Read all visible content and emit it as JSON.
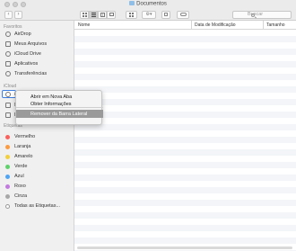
{
  "window": {
    "title": "Documentos"
  },
  "toolbar": {
    "back_label": "‹",
    "forward_label": "›",
    "action_label": "⚙▾",
    "search_placeholder": "Buscar"
  },
  "sidebar": {
    "favorites_header": "Favoritos",
    "favorites": [
      {
        "label": "AirDrop",
        "icon": "airdrop-icon"
      },
      {
        "label": "Meus Arquivos",
        "icon": "all-files-icon"
      },
      {
        "label": "iCloud Drive",
        "icon": "icloud-icon"
      },
      {
        "label": "Aplicativos",
        "icon": "applications-icon"
      },
      {
        "label": "Transferências",
        "icon": "downloads-icon"
      }
    ],
    "icloud_header": "iCloud",
    "icloud_items": [
      {
        "label": "iC",
        "icon": "icloud-icon"
      },
      {
        "label": "Me",
        "icon": "desktop-icon"
      },
      {
        "label": "Do",
        "icon": "documents-icon"
      }
    ],
    "tags_header": "Etiquetas",
    "tags": [
      {
        "label": "Vermelho",
        "color": "#fc605c"
      },
      {
        "label": "Laranja",
        "color": "#fd9b3e"
      },
      {
        "label": "Amarelo",
        "color": "#f3cf3a"
      },
      {
        "label": "Verde",
        "color": "#5ed26b"
      },
      {
        "label": "Azul",
        "color": "#4ea5f5"
      },
      {
        "label": "Roxo",
        "color": "#c379e0"
      },
      {
        "label": "Cinza",
        "color": "#a7a7a7"
      },
      {
        "label": "Todas as Etiquetas...",
        "color": "#ffffff"
      }
    ]
  },
  "columns": {
    "name": "Nome",
    "modified": "Data de Modificação",
    "size": "Tamanho"
  },
  "context_menu": {
    "items": [
      {
        "label": "Abrir em Nova Aba"
      },
      {
        "label": "Obter Informações"
      },
      {
        "label": "Remover da Barra Lateral",
        "highlighted": true
      }
    ]
  }
}
